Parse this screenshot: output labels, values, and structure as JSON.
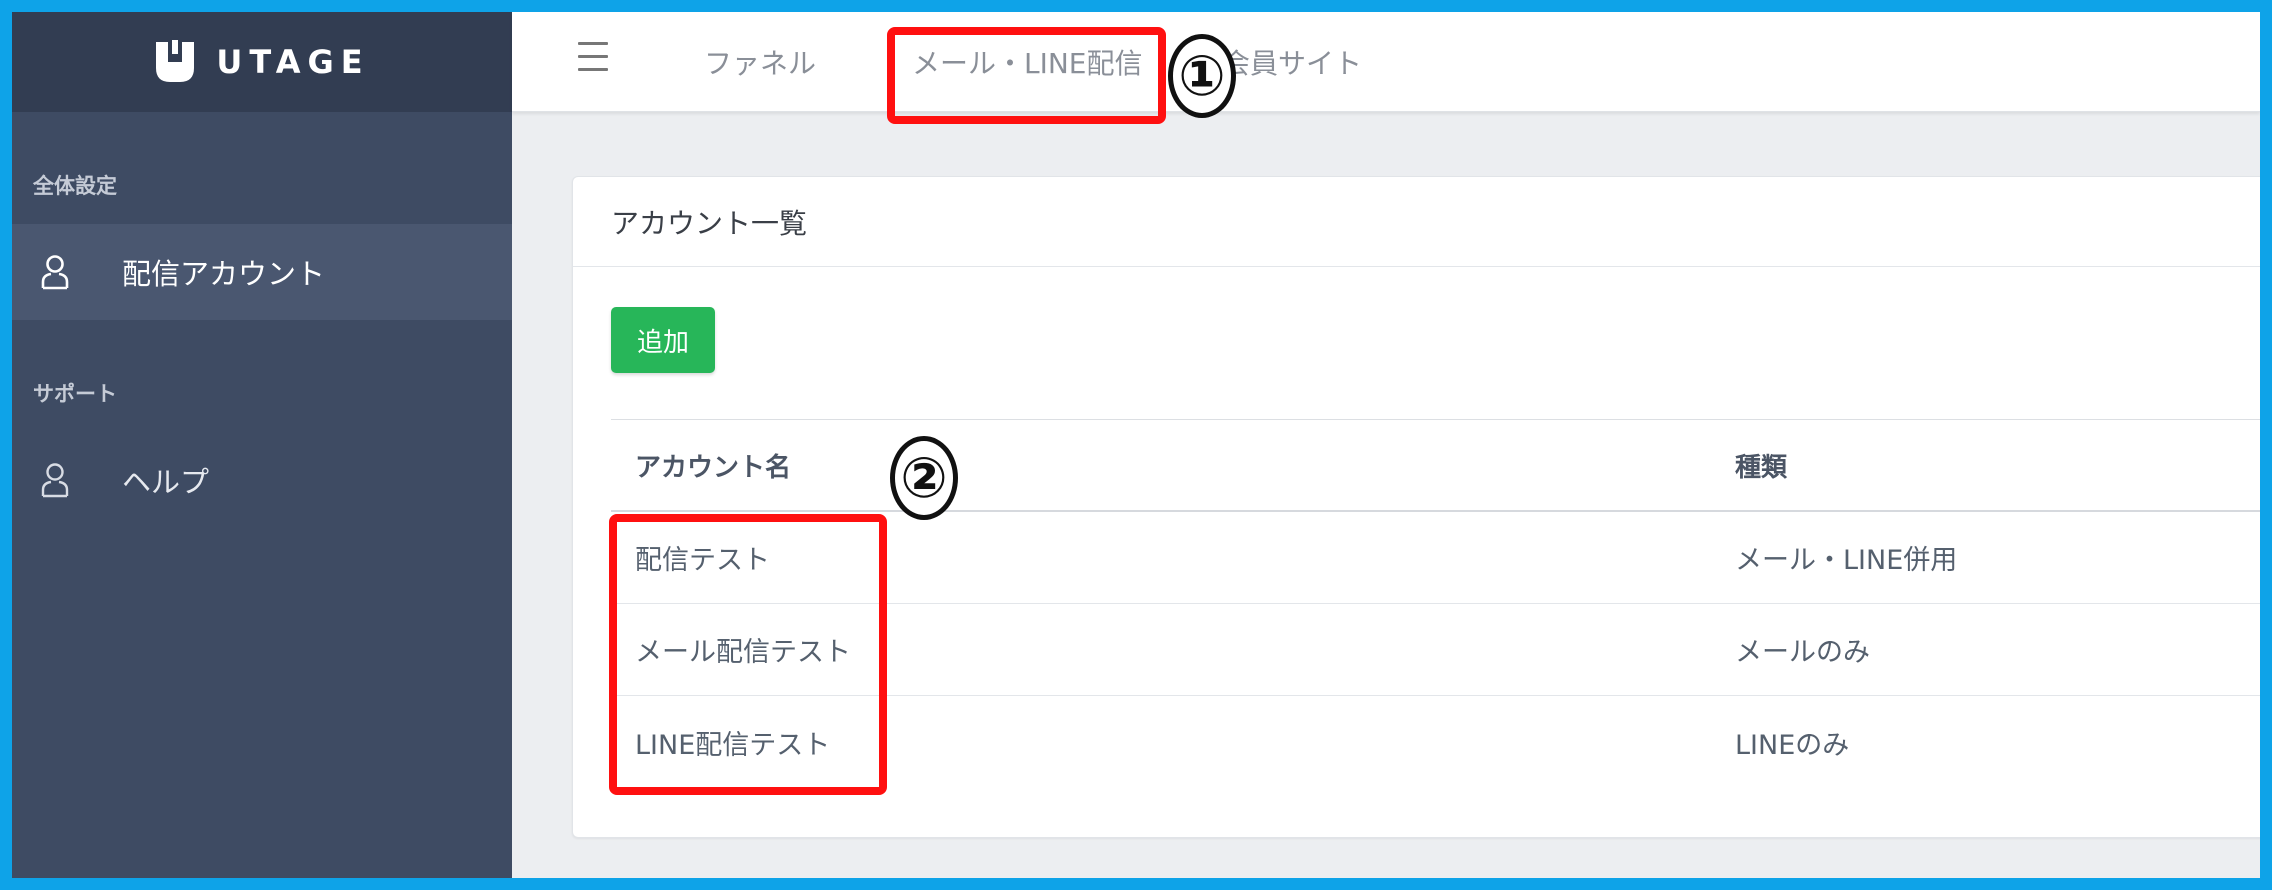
{
  "brand": {
    "name": "UTAGE"
  },
  "sidebar": {
    "sections": [
      {
        "label": "全体設定",
        "items": [
          {
            "label": "配信アカウント",
            "icon": "user-icon",
            "active": true
          }
        ]
      },
      {
        "label": "サポート",
        "items": [
          {
            "label": "ヘルプ",
            "icon": "user-icon",
            "active": false
          }
        ]
      }
    ]
  },
  "topnav": {
    "menu_icon": "hamburger-icon",
    "links": [
      "ファネル",
      "メール・LINE配信",
      "会員サイト"
    ]
  },
  "card": {
    "title": "アカウント一覧",
    "add_button": "追加",
    "table": {
      "columns": [
        "アカウント名",
        "種類"
      ],
      "rows": [
        [
          "配信テスト",
          "メール・LINE併用"
        ],
        [
          "メール配信テスト",
          "メールのみ"
        ],
        [
          "LINE配信テスト",
          "LINEのみ"
        ]
      ]
    }
  },
  "annotations": {
    "markers": [
      "①",
      "②"
    ],
    "color": "#ff1010"
  },
  "colors": {
    "border_frame": "#0ea3e8",
    "sidebar_bg": "#3e4b63",
    "sidebar_header_bg": "#323d52",
    "add_button_bg": "#27b659"
  }
}
